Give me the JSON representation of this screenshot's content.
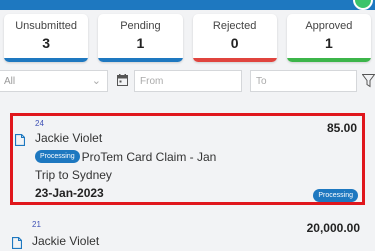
{
  "header": {
    "accent_color": "#1e78c0",
    "avatar_color": "#3cc46b"
  },
  "summary_cards": [
    {
      "label": "Unsubmitted",
      "count": "3",
      "bar_color": "#1e78c0"
    },
    {
      "label": "Pending",
      "count": "1",
      "bar_color": "#1e78c0"
    },
    {
      "label": "Rejected",
      "count": "0",
      "bar_color": "#e0443e"
    },
    {
      "label": "Approved",
      "count": "1",
      "bar_color": "#3cb54a"
    }
  ],
  "filters": {
    "status_value": "All",
    "from_placeholder": "From",
    "to_placeholder": "To",
    "calendar_icon": "calendar-icon",
    "filter_icon": "funnel-icon"
  },
  "claims": [
    {
      "number": "24",
      "name": "Jackie Violet",
      "amount": "85.00",
      "status_chip": "Processing",
      "title": "ProTem Card Claim - Jan",
      "description": "Trip to Sydney",
      "date": "23-Jan-2023",
      "status": "Processing",
      "selected": true
    },
    {
      "number": "21",
      "name": "Jackie Violet",
      "amount": "20,000.00"
    }
  ]
}
